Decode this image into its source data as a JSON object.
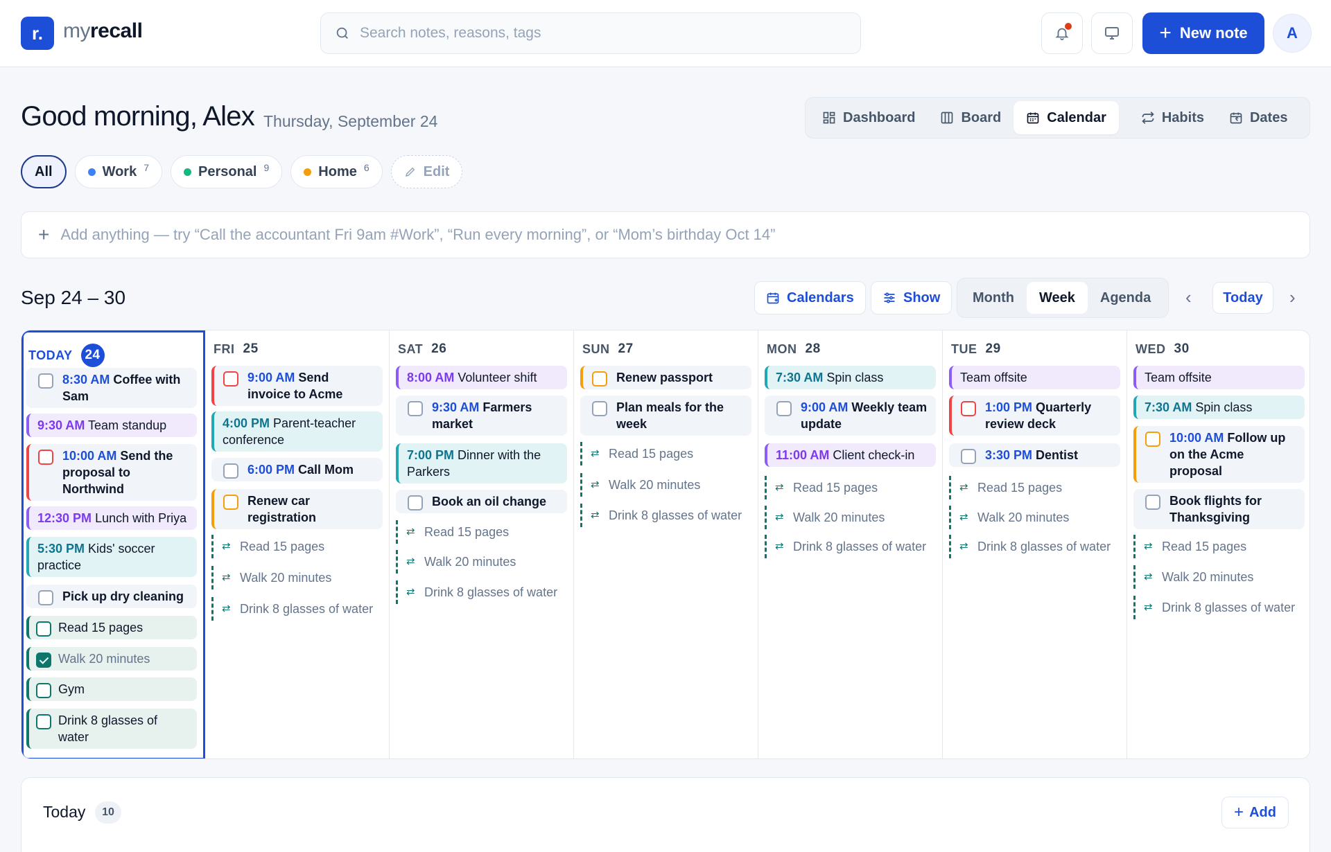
{
  "brand": {
    "logo_letter": "r.",
    "name_light": "my",
    "name_bold": "recall"
  },
  "search": {
    "placeholder": "Search notes, reasons, tags"
  },
  "header": {
    "new_note_label": "New note",
    "avatar_initial": "A"
  },
  "greeting": {
    "title": "Good morning, Alex",
    "date": "Thursday, September 24"
  },
  "views": [
    {
      "label": "Dashboard",
      "icon": "dashboard-icon",
      "active": false
    },
    {
      "label": "Board",
      "icon": "board-icon",
      "active": false
    },
    {
      "label": "Calendar",
      "icon": "calendar-icon",
      "active": true
    },
    {
      "label": "Habits",
      "icon": "repeat-icon",
      "active": false
    },
    {
      "label": "Dates",
      "icon": "calendar-heart-icon",
      "active": false
    }
  ],
  "filters": {
    "all_label": "All",
    "chips": [
      {
        "label": "Work",
        "count": "7",
        "color": "#3b82f6"
      },
      {
        "label": "Personal",
        "count": "9",
        "color": "#10b981"
      },
      {
        "label": "Home",
        "count": "6",
        "color": "#f59e0b"
      }
    ],
    "edit_label": "Edit"
  },
  "quick_add": {
    "placeholder": "Add anything — try “Call the accountant Fri 9am #Work”, “Run every morning”, or “Mom’s birthday Oct 14”"
  },
  "toolbar": {
    "range": "Sep 24 – 30",
    "calendars_label": "Calendars",
    "show_label": "Show",
    "modes": [
      "Month",
      "Week",
      "Agenda"
    ],
    "active_mode": "Week",
    "today_label": "Today"
  },
  "days": [
    {
      "dow": "TODAY",
      "num": "24",
      "today": true,
      "events": [
        {
          "kind": "task",
          "color": "grey",
          "time": "8:30 AM",
          "text": "Coffee with Sam"
        },
        {
          "kind": "event",
          "color": "purple",
          "time": "9:30 AM",
          "text": "Team standup"
        },
        {
          "kind": "task",
          "color": "red",
          "time": "10:00 AM",
          "text": "Send the proposal to Northwind"
        },
        {
          "kind": "event",
          "color": "purple",
          "time": "12:30 PM",
          "text": "Lunch with Priya"
        },
        {
          "kind": "event",
          "color": "teal",
          "time": "5:30 PM",
          "text": "Kids' soccer practice"
        },
        {
          "kind": "task",
          "color": "grey",
          "time": "",
          "text": "Pick up dry cleaning"
        },
        {
          "kind": "habit-task",
          "text": "Read 15 pages",
          "done": false
        },
        {
          "kind": "habit-task",
          "text": "Walk 20 minutes",
          "done": true
        },
        {
          "kind": "habit-task",
          "text": "Gym",
          "done": false
        },
        {
          "kind": "habit-task",
          "text": "Drink 8 glasses of water",
          "done": false
        }
      ]
    },
    {
      "dow": "FRI",
      "num": "25",
      "events": [
        {
          "kind": "task",
          "color": "red",
          "time": "9:00 AM",
          "text": "Send invoice to Acme"
        },
        {
          "kind": "event",
          "color": "teal",
          "time": "4:00 PM",
          "text": "Parent-teacher conference"
        },
        {
          "kind": "task",
          "color": "grey",
          "time": "6:00 PM",
          "text": "Call Mom"
        },
        {
          "kind": "task",
          "color": "orange",
          "time": "",
          "text": "Renew car registration"
        },
        {
          "kind": "habit",
          "text": "Read 15 pages"
        },
        {
          "kind": "habit",
          "text": "Walk 20 minutes"
        },
        {
          "kind": "habit",
          "text": "Drink 8 glasses of water"
        }
      ]
    },
    {
      "dow": "SAT",
      "num": "26",
      "events": [
        {
          "kind": "event",
          "color": "purple",
          "time": "8:00 AM",
          "text": "Volunteer shift"
        },
        {
          "kind": "task",
          "color": "grey",
          "time": "9:30 AM",
          "text": "Farmers market"
        },
        {
          "kind": "event",
          "color": "teal",
          "time": "7:00 PM",
          "text": "Dinner with the Parkers"
        },
        {
          "kind": "task",
          "color": "grey",
          "time": "",
          "text": "Book an oil change"
        },
        {
          "kind": "habit",
          "text": "Read 15 pages"
        },
        {
          "kind": "habit",
          "text": "Walk 20 minutes"
        },
        {
          "kind": "habit",
          "text": "Drink 8 glasses of water"
        }
      ]
    },
    {
      "dow": "SUN",
      "num": "27",
      "events": [
        {
          "kind": "task",
          "color": "orange",
          "time": "",
          "text": "Renew passport"
        },
        {
          "kind": "task",
          "color": "grey",
          "time": "",
          "text": "Plan meals for the week"
        },
        {
          "kind": "habit",
          "text": "Read 15 pages"
        },
        {
          "kind": "habit",
          "text": "Walk 20 minutes"
        },
        {
          "kind": "habit",
          "text": "Drink 8 glasses of water"
        }
      ]
    },
    {
      "dow": "MON",
      "num": "28",
      "events": [
        {
          "kind": "event",
          "color": "teal",
          "time": "7:30 AM",
          "text": "Spin class"
        },
        {
          "kind": "task",
          "color": "grey",
          "time": "9:00 AM",
          "text": "Weekly team update"
        },
        {
          "kind": "event",
          "color": "purple",
          "time": "11:00 AM",
          "text": "Client check-in"
        },
        {
          "kind": "habit",
          "text": "Read 15 pages"
        },
        {
          "kind": "habit",
          "text": "Walk 20 minutes"
        },
        {
          "kind": "habit",
          "text": "Drink 8 glasses of water"
        }
      ]
    },
    {
      "dow": "TUE",
      "num": "29",
      "events": [
        {
          "kind": "event",
          "color": "purple",
          "time": "",
          "text": "Team offsite"
        },
        {
          "kind": "task",
          "color": "red",
          "time": "1:00 PM",
          "text": "Quarterly review deck"
        },
        {
          "kind": "task",
          "color": "grey",
          "time": "3:30 PM",
          "text": "Dentist"
        },
        {
          "kind": "habit",
          "text": "Read 15 pages"
        },
        {
          "kind": "habit",
          "text": "Walk 20 minutes"
        },
        {
          "kind": "habit",
          "text": "Drink 8 glasses of water"
        }
      ]
    },
    {
      "dow": "WED",
      "num": "30",
      "events": [
        {
          "kind": "event",
          "color": "purple",
          "time": "",
          "text": "Team offsite"
        },
        {
          "kind": "event",
          "color": "teal",
          "time": "7:30 AM",
          "text": "Spin class"
        },
        {
          "kind": "task",
          "color": "orange",
          "time": "10:00 AM",
          "text": "Follow up on the Acme proposal"
        },
        {
          "kind": "task",
          "color": "grey",
          "time": "",
          "text": "Book flights for Thanksgiving"
        },
        {
          "kind": "habit",
          "text": "Read 15 pages"
        },
        {
          "kind": "habit",
          "text": "Walk 20 minutes"
        },
        {
          "kind": "habit",
          "text": "Drink 8 glasses of water"
        }
      ]
    }
  ],
  "today_panel": {
    "title": "Today",
    "count": "10",
    "add_label": "Add"
  }
}
